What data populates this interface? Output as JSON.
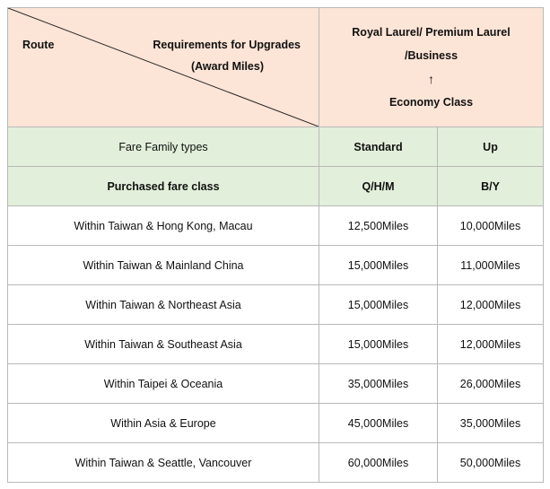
{
  "corner": {
    "route_label": "Route",
    "requirements_line1": "Requirements for Upgrades",
    "requirements_line2": "(Award Miles)"
  },
  "class_header": {
    "line1": "Royal Laurel/ Premium Laurel",
    "line2": "/Business",
    "arrow": "↑",
    "line3": "Economy Class"
  },
  "fare_family": {
    "label": "Fare Family types",
    "standard": "Standard",
    "up": "Up"
  },
  "purchased_class": {
    "label": "Purchased fare class",
    "standard": "Q/H/M",
    "up": "B/Y"
  },
  "rows": [
    {
      "route": "Within Taiwan & Hong Kong, Macau",
      "standard": "12,500Miles",
      "up": "10,000Miles"
    },
    {
      "route": "Within Taiwan & Mainland China",
      "standard": "15,000Miles",
      "up": "11,000Miles"
    },
    {
      "route": "Within Taiwan & Northeast Asia",
      "standard": "15,000Miles",
      "up": "12,000Miles"
    },
    {
      "route": "Within Taiwan & Southeast Asia",
      "standard": "15,000Miles",
      "up": "12,000Miles"
    },
    {
      "route": "Within Taipei & Oceania",
      "standard": "35,000Miles",
      "up": "26,000Miles"
    },
    {
      "route": "Within Asia & Europe",
      "standard": "45,000Miles",
      "up": "35,000Miles"
    },
    {
      "route": "Within Taiwan & Seattle, Vancouver",
      "standard": "60,000Miles",
      "up": "50,000Miles"
    }
  ],
  "colors": {
    "header_bg": "#fce4d6",
    "fare_bg": "#e2efda",
    "border": "#b9b9b9"
  }
}
